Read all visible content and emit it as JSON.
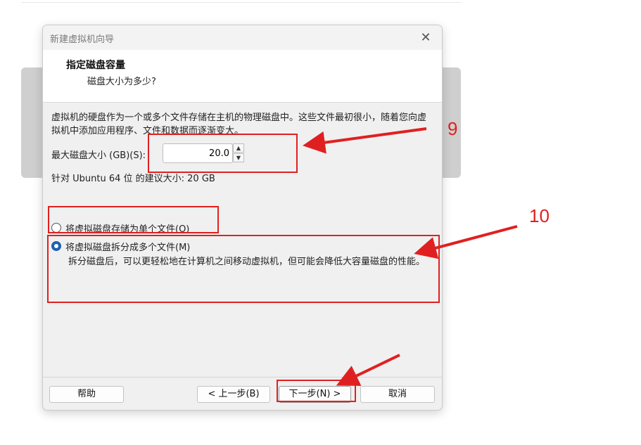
{
  "window": {
    "title": "新建虚拟机向导",
    "close_glyph": "✕"
  },
  "header": {
    "title": "指定磁盘容量",
    "subtitle": "磁盘大小为多少?"
  },
  "description": "虚拟机的硬盘作为一个或多个文件存储在主机的物理磁盘中。这些文件最初很小，随着您向虚拟机中添加应用程序、文件和数据而逐渐变大。",
  "disk_size": {
    "label": "最大磁盘大小 (GB)(S):",
    "value": "20.0",
    "spin_up": "▲",
    "spin_down": "▼"
  },
  "recommendation": "针对 Ubuntu 64 位 的建议大小: 20 GB",
  "options": [
    {
      "label": "将虚拟磁盘存储为单个文件(O)",
      "checked": false
    },
    {
      "label": "将虚拟磁盘拆分成多个文件(M)",
      "checked": true
    }
  ],
  "split_description": "拆分磁盘后，可以更轻松地在计算机之间移动虚拟机，但可能会降低大容量磁盘的性能。",
  "buttons": {
    "help": "帮助",
    "back": "< 上一步(B)",
    "next": "下一步(N) >",
    "cancel": "取消"
  },
  "annotations": {
    "step9": "9",
    "step10": "10",
    "color": "#e02020"
  }
}
